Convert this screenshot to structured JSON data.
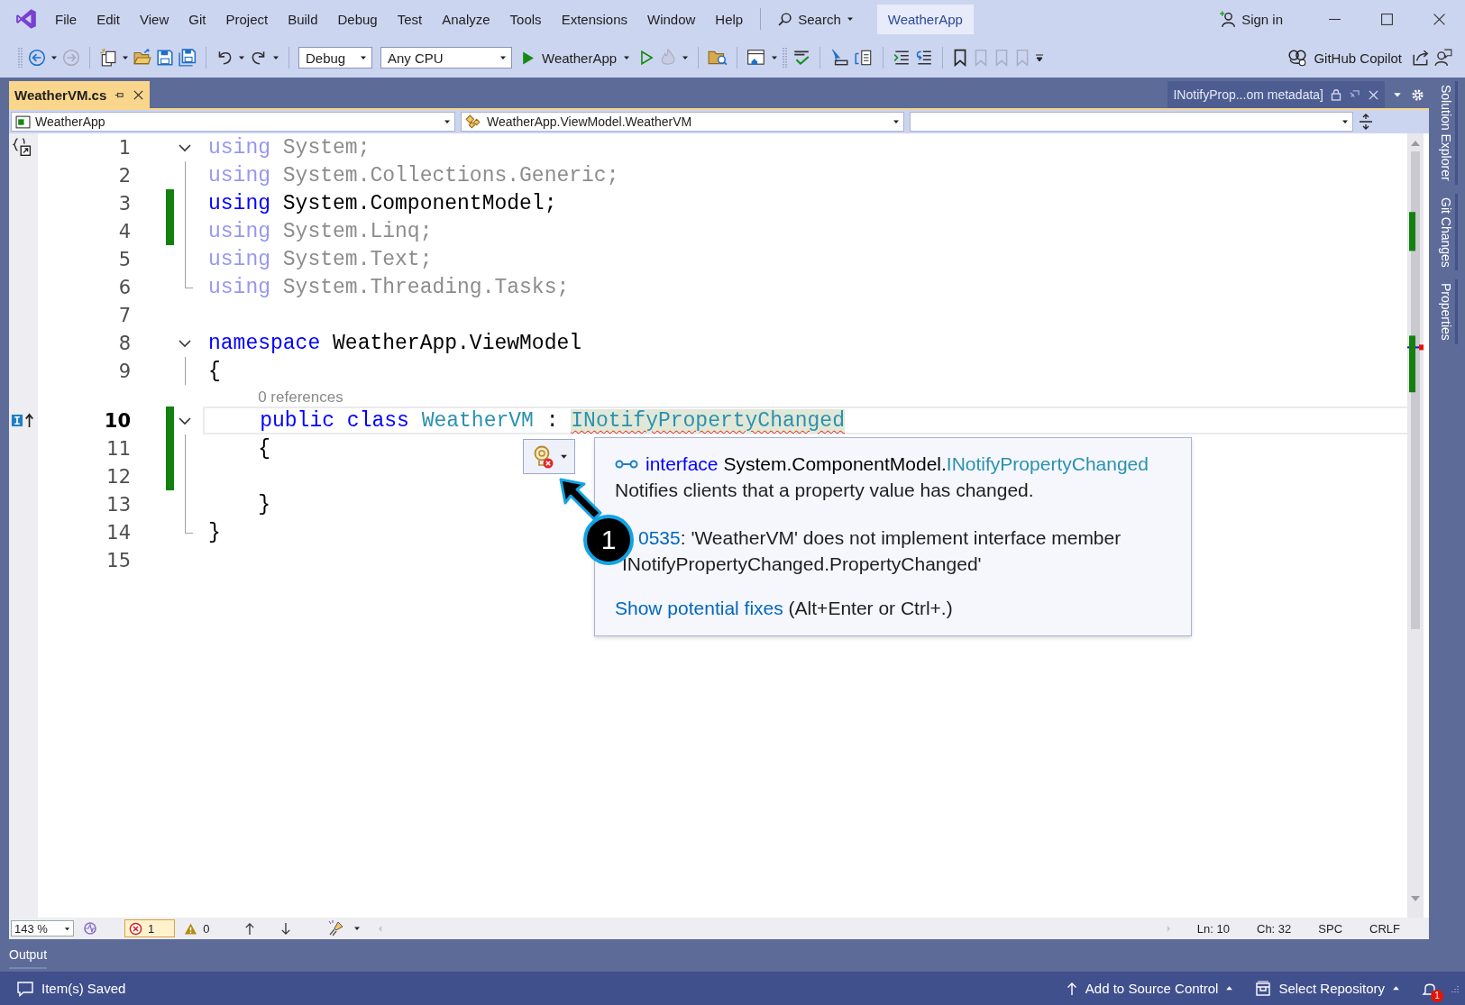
{
  "menu_bar": {
    "items": [
      "File",
      "Edit",
      "View",
      "Git",
      "Project",
      "Build",
      "Debug",
      "Test",
      "Analyze",
      "Tools",
      "Extensions",
      "Window",
      "Help"
    ],
    "search": "Search",
    "solution": "WeatherApp",
    "sign_in": "Sign in"
  },
  "toolbar": {
    "configuration": "Debug",
    "platform": "Any CPU",
    "start_target": "WeatherApp",
    "copilot": "GitHub Copilot"
  },
  "document_tabs": [
    {
      "label": "WeatherVM.cs",
      "kind": "document",
      "selected": true
    },
    {
      "label": "INotifyProp...om metadata]",
      "kind": "preview",
      "selected": false
    }
  ],
  "navigation_bar": {
    "project": "WeatherApp",
    "type": "WeatherApp.ViewModel.WeatherVM"
  },
  "code_lines": [
    {
      "number": "1",
      "fold": {
        "kind": "start"
      },
      "margin_icon": {
        "kind": "scope"
      },
      "unused": true,
      "changed": false,
      "current": false,
      "tokens": [
        {
          "kind": "keyword",
          "text": "using"
        },
        {
          "kind": "text",
          "text": " System;"
        }
      ]
    },
    {
      "number": "2",
      "fold": {
        "kind": "inner"
      },
      "unused": true,
      "changed": false,
      "current": false,
      "tokens": [
        {
          "kind": "keyword",
          "text": "using"
        },
        {
          "kind": "text",
          "text": " System.Collections.Generic;"
        }
      ]
    },
    {
      "number": "3",
      "fold": {
        "kind": "inner"
      },
      "unused": false,
      "changed": true,
      "current": false,
      "tokens": [
        {
          "kind": "keyword",
          "text": "using"
        },
        {
          "kind": "text",
          "text": " System.ComponentModel;"
        }
      ]
    },
    {
      "number": "4",
      "fold": {
        "kind": "inner"
      },
      "unused": true,
      "changed": true,
      "current": false,
      "tokens": [
        {
          "kind": "keyword",
          "text": "using"
        },
        {
          "kind": "text",
          "text": " System.Linq;"
        }
      ]
    },
    {
      "number": "5",
      "fold": {
        "kind": "inner"
      },
      "unused": true,
      "changed": false,
      "current": false,
      "tokens": [
        {
          "kind": "keyword",
          "text": "using"
        },
        {
          "kind": "text",
          "text": " System.Text;"
        }
      ]
    },
    {
      "number": "6",
      "fold": {
        "kind": "end"
      },
      "unused": true,
      "changed": false,
      "current": false,
      "tokens": [
        {
          "kind": "keyword",
          "text": "using"
        },
        {
          "kind": "text",
          "text": " System.Threading.Tasks;"
        }
      ]
    },
    {
      "number": "7",
      "unused": false,
      "changed": false,
      "current": false
    },
    {
      "number": "8",
      "fold": {
        "kind": "start"
      },
      "unused": false,
      "changed": false,
      "current": false,
      "tokens": [
        {
          "kind": "keyword",
          "text": "namespace"
        },
        {
          "kind": "text",
          "text": " WeatherApp.ViewModel"
        }
      ]
    },
    {
      "number": "9",
      "fold": {
        "kind": "inner"
      },
      "unused": false,
      "changed": false,
      "current": false,
      "tokens": [
        {
          "kind": "text",
          "text": "{"
        }
      ]
    },
    {
      "number": "10",
      "fold": {
        "kind": "start"
      },
      "margin_icon": {
        "kind": "implements"
      },
      "codelens": "0 references",
      "unused": false,
      "changed": true,
      "current": true,
      "tokens": [
        {
          "kind": "keyword",
          "text": "    public"
        },
        {
          "kind": "keyword",
          "text": " class"
        },
        {
          "kind": "type",
          "text": " WeatherVM"
        },
        {
          "kind": "text",
          "text": " : "
        },
        {
          "kind": "type",
          "text": "INotifyPropertyChanged",
          "error": true
        }
      ]
    },
    {
      "number": "11",
      "fold": {
        "kind": "inner"
      },
      "unused": false,
      "changed": true,
      "current": false,
      "tokens": [
        {
          "kind": "text",
          "text": "    {"
        }
      ]
    },
    {
      "number": "12",
      "fold": {
        "kind": "inner"
      },
      "unused": false,
      "changed": true,
      "current": false
    },
    {
      "number": "13",
      "fold": {
        "kind": "inner"
      },
      "unused": false,
      "changed": false,
      "current": false,
      "tokens": [
        {
          "kind": "text",
          "text": "    }"
        }
      ]
    },
    {
      "number": "14",
      "fold": {
        "kind": "end"
      },
      "unused": false,
      "changed": false,
      "current": false,
      "tokens": [
        {
          "kind": "text",
          "text": "}"
        }
      ]
    },
    {
      "number": "15",
      "unused": false,
      "changed": false,
      "current": false
    }
  ],
  "quick_info": {
    "signature": [
      {
        "kind": "keyword",
        "text": "interface"
      },
      {
        "kind": "text",
        "text": " System.ComponentModel."
      },
      {
        "kind": "type",
        "text": "INotifyPropertyChanged"
      }
    ],
    "description": "Notifies clients that a property value has changed.",
    "error_code": "0535",
    "error_message": ": 'WeatherVM' does not implement interface member 'INotifyPropertyChanged.PropertyChanged'",
    "fix_link": "Show potential fixes",
    "fix_shortcut": " (Alt+Enter or Ctrl+.)"
  },
  "callout": "1",
  "editor_status": {
    "zoom": "143 %",
    "errors": "1",
    "warnings": "0",
    "line": "Ln: 10",
    "column": "Ch: 32",
    "whitespace": "SPC",
    "line_ending": "CRLF"
  },
  "tool_window_tabs": [
    {
      "label": "Output"
    }
  ],
  "side_tabs": [
    "Solution Explorer",
    "Git Changes",
    "Properties"
  ],
  "status_bar": {
    "message": "Item(s) Saved",
    "source_control": "Add to Source Control",
    "repository": "Select Repository",
    "notifications": "1"
  }
}
